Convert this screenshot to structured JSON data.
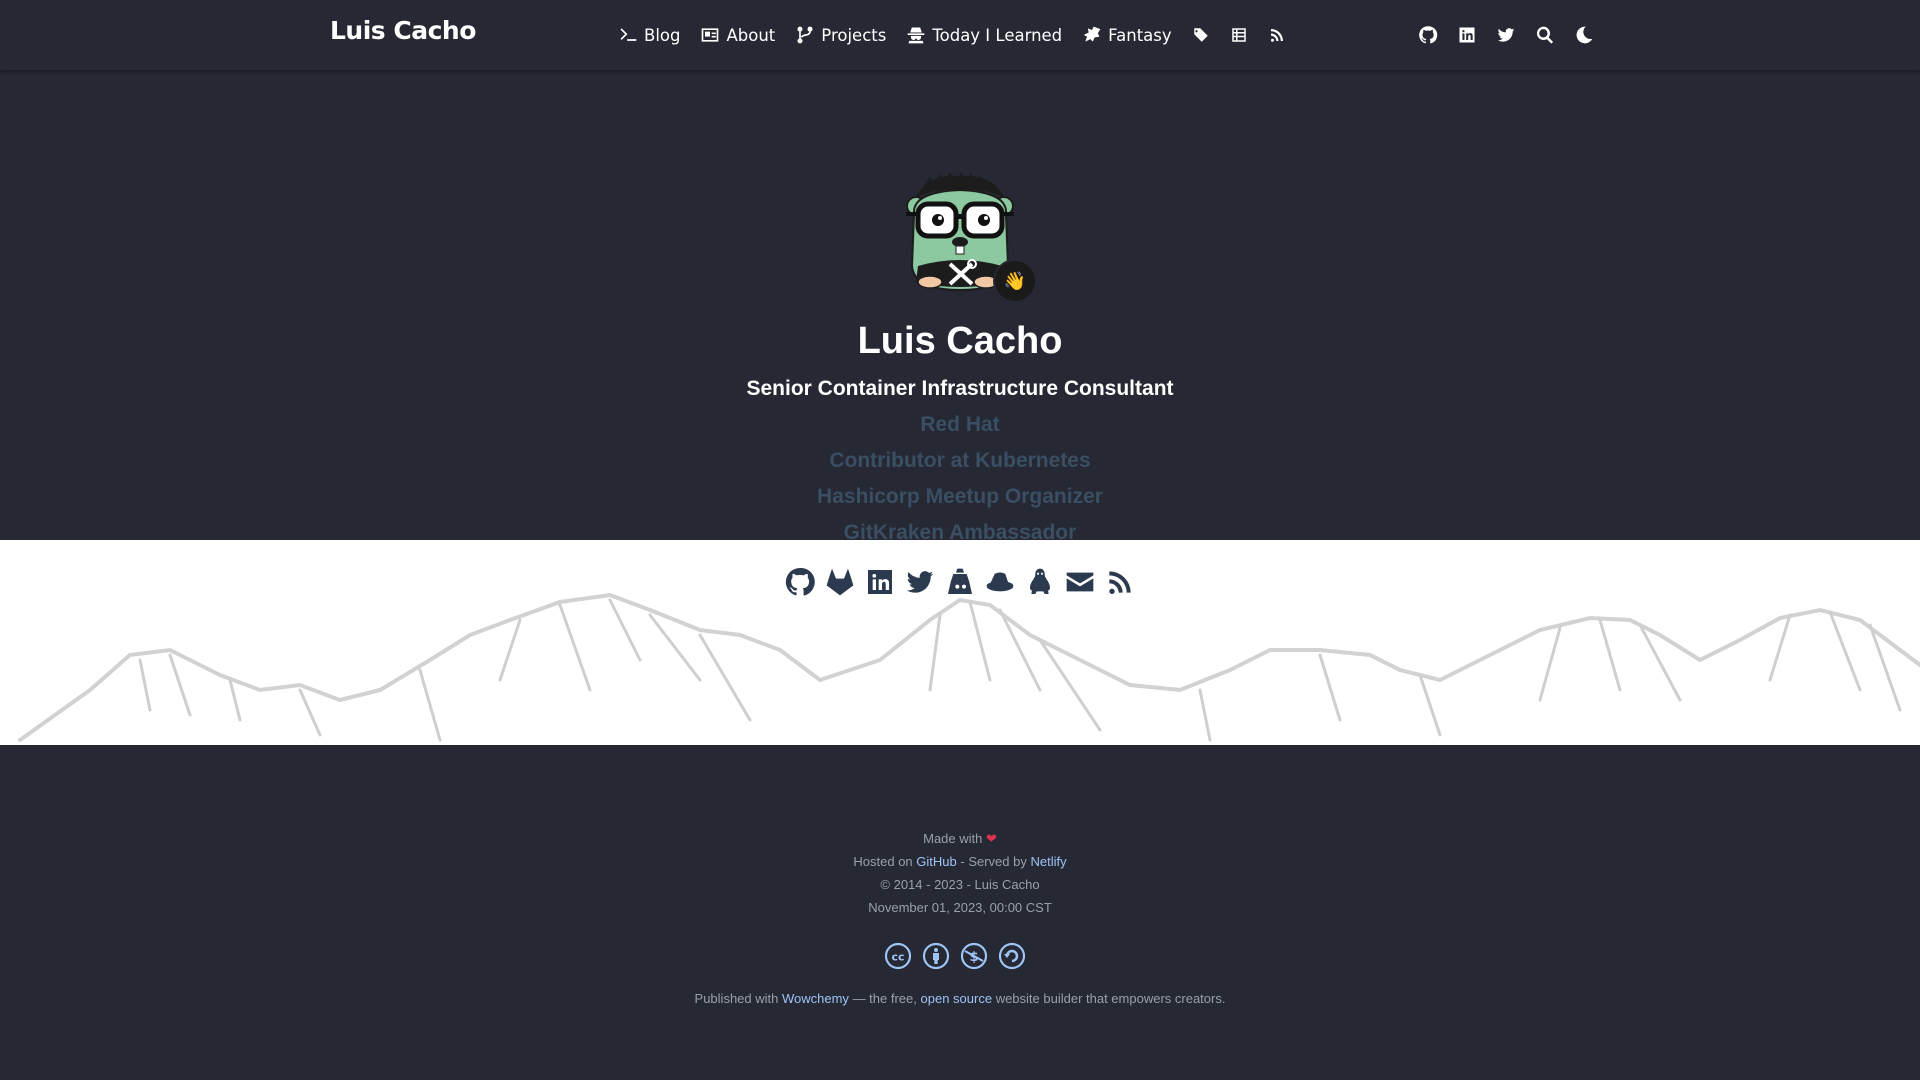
{
  "navbar": {
    "brand": "Luis Cacho",
    "menu": [
      {
        "label": "Blog",
        "icon": "terminal-icon"
      },
      {
        "label": "About",
        "icon": "id-card-icon"
      },
      {
        "label": "Projects",
        "icon": "code-branch-icon"
      },
      {
        "label": "Today I Learned",
        "icon": "user-secret-icon"
      },
      {
        "label": "Fantasy",
        "icon": "dragon-icon"
      },
      {
        "label": "",
        "icon": "tags-icon"
      },
      {
        "label": "",
        "icon": "table-list-icon"
      },
      {
        "label": "",
        "icon": "rss-icon"
      }
    ],
    "right_icons": [
      "github-icon",
      "linkedin-icon",
      "twitter-icon",
      "search-icon",
      "moon-icon"
    ]
  },
  "hero": {
    "name": "Luis Cacho",
    "role": "Senior Container Infrastructure Consultant",
    "orgs": [
      "Red Hat",
      "Contributor at Kubernetes",
      "Hashicorp Meetup Organizer",
      "GitKraken Ambassador"
    ],
    "status_emoji": "👋",
    "avatar_icon": "gopher-avatar",
    "social_icons": [
      "github-icon",
      "gitlab-icon",
      "linkedin-icon",
      "twitter-icon",
      "keybase-icon",
      "redhat-icon",
      "linux-icon",
      "envelope-icon",
      "rss-icon"
    ]
  },
  "footer": {
    "made_with": "Made with",
    "heart": "❤",
    "hosted_on": "Hosted on",
    "github": "GitHub",
    "served_by": "- Served by",
    "netlify": "Netlify",
    "copyright": "© 2014 - 2023 - Luis Cacho",
    "date": "November 01, 2023, 00:00 CST",
    "license_icons": [
      "cc-icon",
      "cc-by-icon",
      "cc-nc-icon",
      "cc-sa-icon"
    ],
    "published_with": "Published with",
    "wowchemy": "Wowchemy",
    "free_text": "— the free,",
    "open_source": "open source",
    "builder_text": "website builder that empowers creators."
  },
  "colors": {
    "background": "#262834",
    "mountain_bg": "#ffffff",
    "org_text": "#3a4f63",
    "link": "#9ec3f5",
    "heart": "#e0324b",
    "social_icon": "#2b3a4e"
  }
}
